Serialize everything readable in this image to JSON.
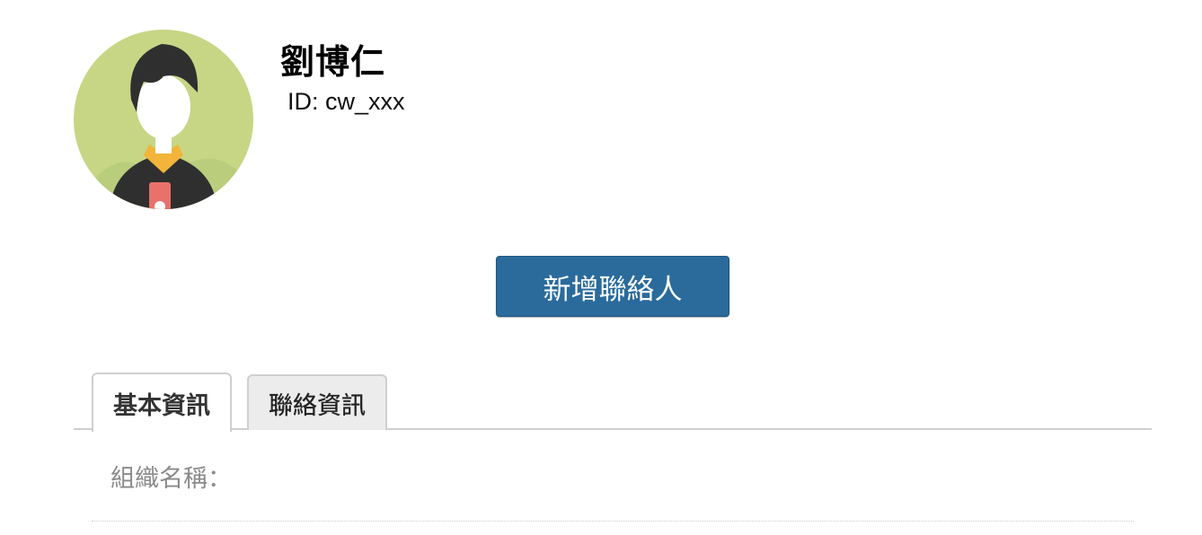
{
  "profile": {
    "name": "劉博仁",
    "id_label": "ID: cw_xxx",
    "avatar_icon": "user-avatar-icon"
  },
  "actions": {
    "add_contact_label": "新增聯絡人",
    "add_contact_color": "#2a6b9c"
  },
  "tabs": [
    {
      "label": "基本資訊",
      "active": true
    },
    {
      "label": "聯絡資訊",
      "active": false
    }
  ],
  "fields": [
    {
      "label": "組織名稱：",
      "value": ""
    }
  ],
  "colors": {
    "avatar_background": "#c6d684",
    "tab_inactive_background": "#ececec",
    "label_gray": "#8a8a8a"
  }
}
